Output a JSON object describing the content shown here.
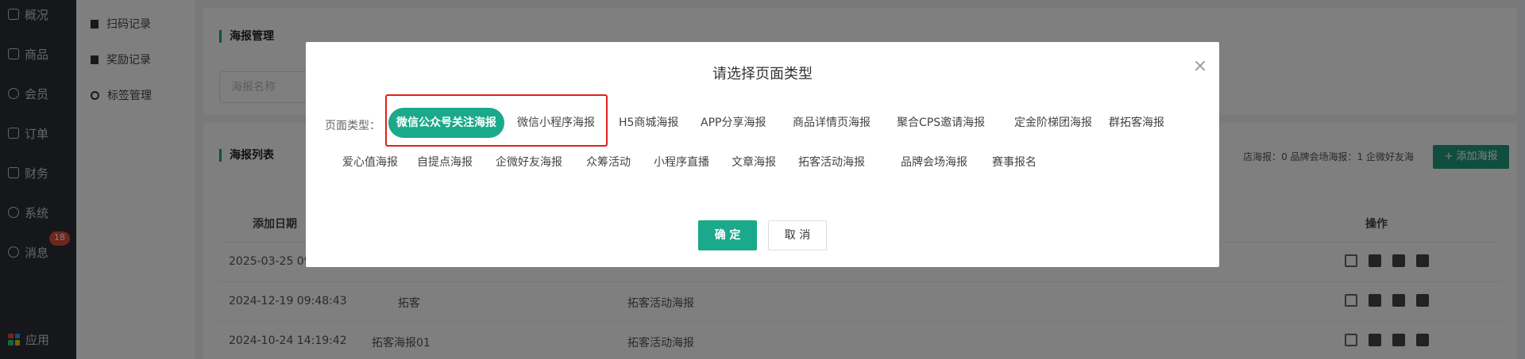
{
  "nav": {
    "items": [
      {
        "label": "概况",
        "icon": "chart-icon"
      },
      {
        "label": "商品",
        "icon": "box-icon"
      },
      {
        "label": "会员",
        "icon": "user-icon"
      },
      {
        "label": "订单",
        "icon": "cart-icon"
      },
      {
        "label": "财务",
        "icon": "wallet-icon"
      },
      {
        "label": "系统",
        "icon": "gear-icon"
      },
      {
        "label": "消息",
        "icon": "chat-icon"
      }
    ],
    "message_badge": "18",
    "apps_label": "应用"
  },
  "subnav": {
    "items": [
      {
        "label": "扫码记录"
      },
      {
        "label": "奖励记录"
      },
      {
        "label": "标签管理"
      }
    ]
  },
  "content": {
    "section_title": "海报管理",
    "search_placeholder": "海报名称",
    "list_title": "海报列表",
    "stats_text": "店海报：0  品牌会场海报：1  企微好友海",
    "add_button": "+ 添加海报",
    "table": {
      "headers": {
        "date": "添加日期",
        "ops": "操作"
      },
      "rows": [
        {
          "date": "2025-03-25 09:1",
          "name": "",
          "type": ""
        },
        {
          "date": "2024-12-19 09:48:43",
          "name": "拓客",
          "type": "拓客活动海报"
        },
        {
          "date": "2024-10-24 14:19:42",
          "name": "拓客海报01",
          "type": "拓客活动海报"
        }
      ]
    }
  },
  "modal": {
    "title": "请选择页面类型",
    "type_label": "页面类型：",
    "options_row1": [
      "微信公众号关注海报",
      "微信小程序海报",
      "H5商城海报",
      "APP分享海报",
      "商品详情页海报",
      "聚合CPS邀请海报",
      "定金阶梯团海报",
      "群拓客海报"
    ],
    "options_row2": [
      "爱心值海报",
      "自提点海报",
      "企微好友海报",
      "众筹活动",
      "小程序直播",
      "文章海报",
      "拓客活动海报",
      "品牌会场海报",
      "赛事报名"
    ],
    "selected": "微信公众号关注海报",
    "ok_label": "确 定",
    "cancel_label": "取 消",
    "close_symbol": "×"
  },
  "colors": {
    "accent": "#1aa98a",
    "highlight_border": "#e1201b",
    "nav_bg": "#2b2f36"
  }
}
